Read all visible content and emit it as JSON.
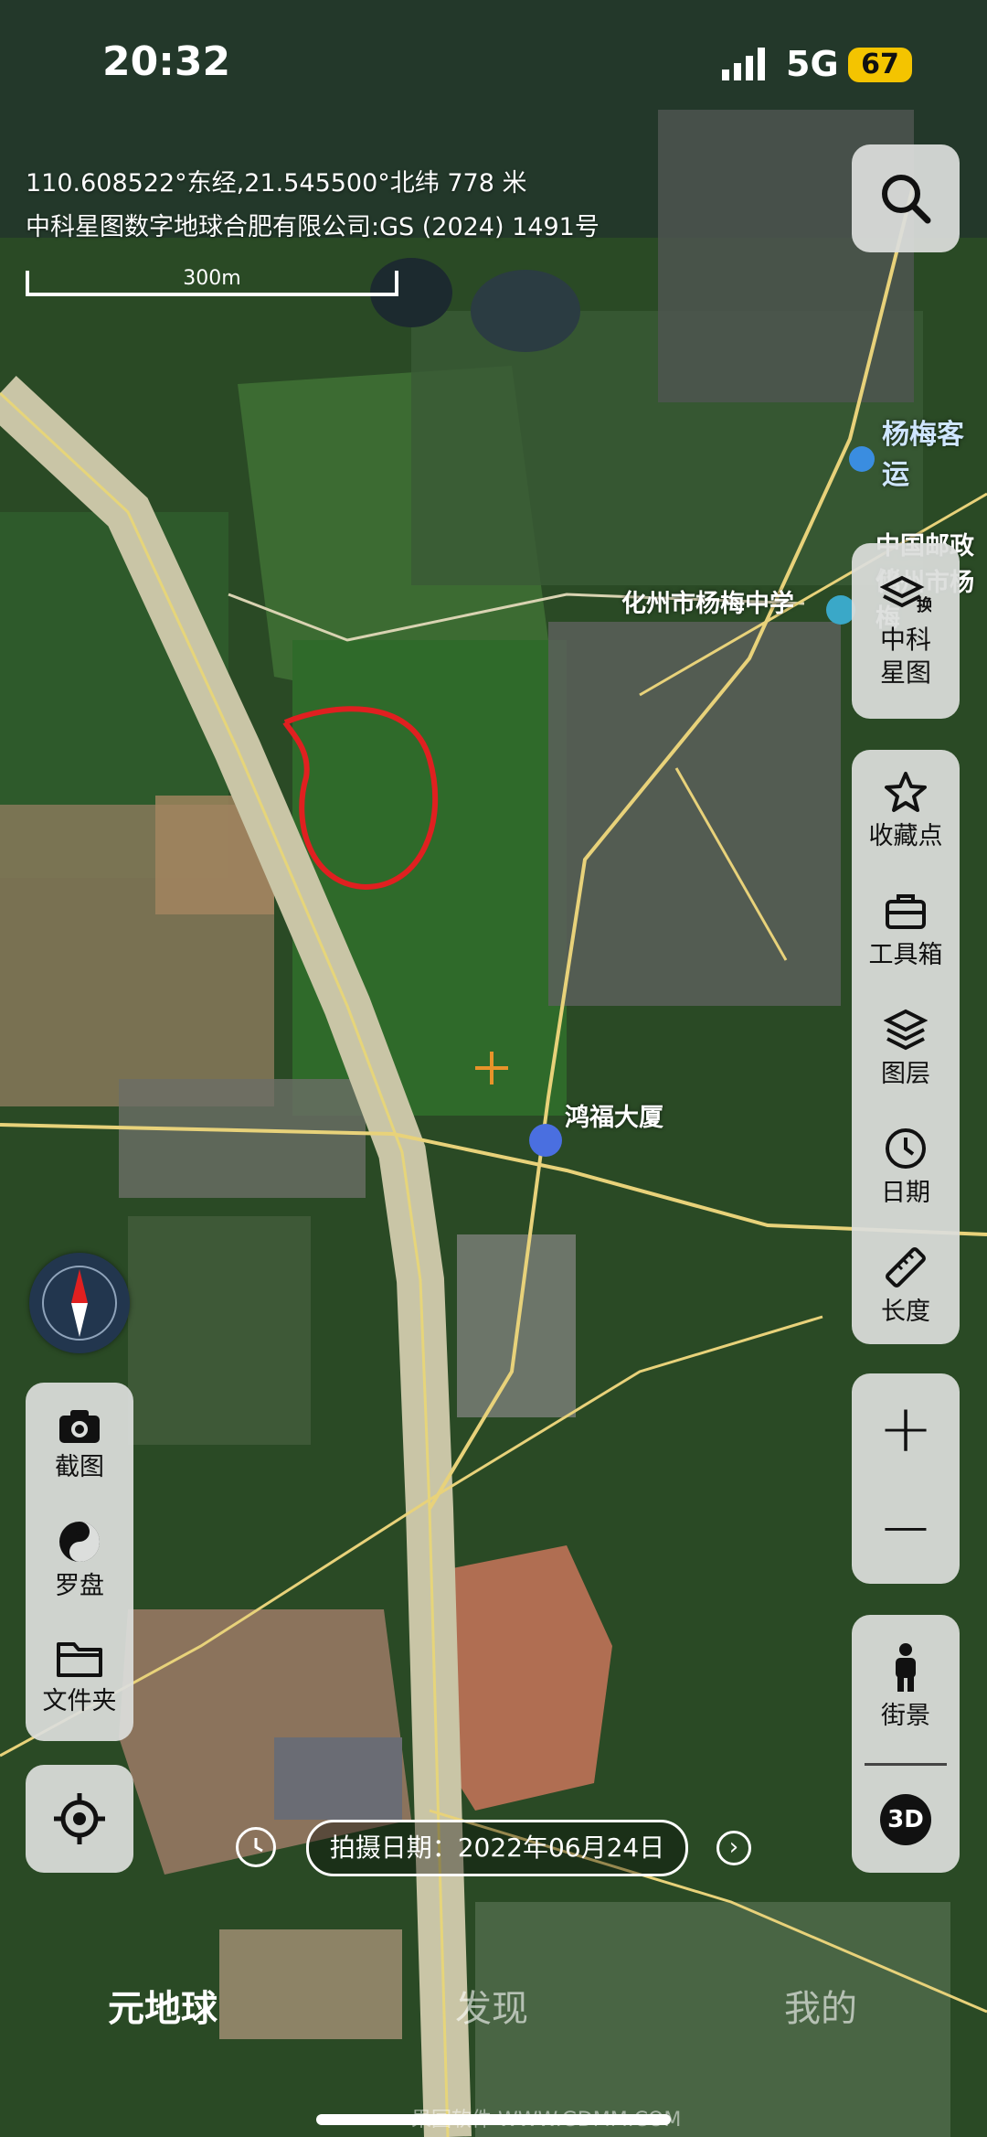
{
  "status_bar": {
    "time": "20:32",
    "network": "5G",
    "battery": "67"
  },
  "map_info": {
    "coordinates": "110.608522°东经,21.545500°北纬 778 米",
    "copyright": "中科星图数字地球合肥有限公司:GS (2024) 1491号",
    "scale": "300m"
  },
  "map_labels": {
    "bus_stop": "杨梅客运",
    "post_office": "中国邮政储",
    "post_office_2": "化州市杨梅",
    "school": "化州市杨梅中学",
    "building": "鸿福大厦"
  },
  "right_panel": {
    "search_icon": "search-icon",
    "layer_switch": "中科\n星图",
    "favorites": "收藏点",
    "toolbox": "工具箱",
    "layers": "图层",
    "date": "日期",
    "length": "长度",
    "zoom_in": "+",
    "zoom_out": "−",
    "street_view": "街景",
    "three_d": "3D"
  },
  "left_panel": {
    "screenshot": "截图",
    "compass": "罗盘",
    "folder": "文件夹"
  },
  "capture_date": {
    "label": "拍摄日期：",
    "value": "2022年06月24日"
  },
  "tabs": [
    "元地球",
    "发现",
    "我的"
  ],
  "watermark": "果园软件 WWW.GDMM.COM",
  "colors": {
    "accent_orange": "#e8932a",
    "red_circle": "#e02020",
    "battery": "#f4c400",
    "road": "#e8d27a"
  }
}
